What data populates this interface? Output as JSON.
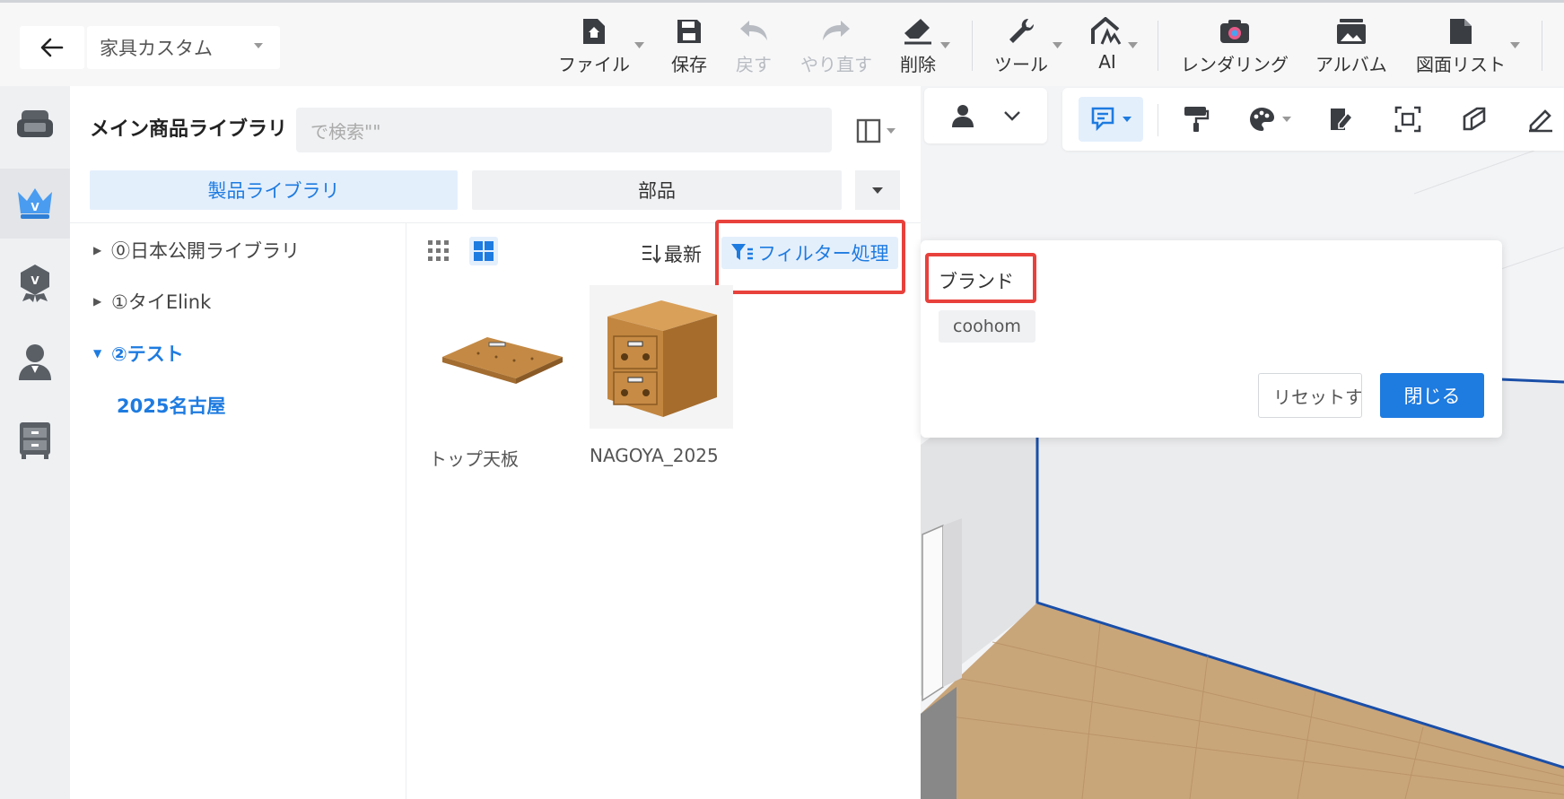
{
  "header": {
    "project_name": "家具カスタム",
    "toolbar": [
      {
        "label": "ファイル",
        "icon": "file-home-icon",
        "disabled": false
      },
      {
        "label": "保存",
        "icon": "save-icon",
        "disabled": false
      },
      {
        "label": "戻す",
        "icon": "undo-icon",
        "disabled": true
      },
      {
        "label": "やり直す",
        "icon": "redo-icon",
        "disabled": true
      },
      {
        "label": "削除",
        "icon": "eraser-icon",
        "disabled": false
      },
      {
        "label": "ツール",
        "icon": "wrench-icon",
        "disabled": false
      },
      {
        "label": "AI",
        "icon": "ai-icon",
        "disabled": false
      },
      {
        "label": "レンダリング",
        "icon": "camera-icon",
        "disabled": false
      },
      {
        "label": "アルバム",
        "icon": "album-icon",
        "disabled": false
      },
      {
        "label": "図面リスト",
        "icon": "drawing-list-icon",
        "disabled": false
      }
    ]
  },
  "library": {
    "title": "メイン商品ライブラリ",
    "search_placeholder": "で検索\"\"",
    "tabs": {
      "products": "製品ライブラリ",
      "parts": "部品"
    },
    "tree": [
      {
        "label": "⓪日本公開ライブラリ",
        "expanded": false
      },
      {
        "label": "①タイElink",
        "expanded": false
      },
      {
        "label": "②テスト",
        "expanded": true
      },
      {
        "label": "2025名古屋",
        "child": true
      }
    ],
    "sort_label": "最新",
    "filter_label": "フィルター処理",
    "products": [
      {
        "name": "トップ天板"
      },
      {
        "name": "NAGOYA_2025"
      }
    ]
  },
  "filter_popup": {
    "brand_label": "ブランド",
    "brand_tag": "coohom",
    "reset_label": "リセットする",
    "close_label": "閉じる"
  },
  "colors": {
    "accent": "#1e7be0",
    "highlight": "#e8413c"
  }
}
